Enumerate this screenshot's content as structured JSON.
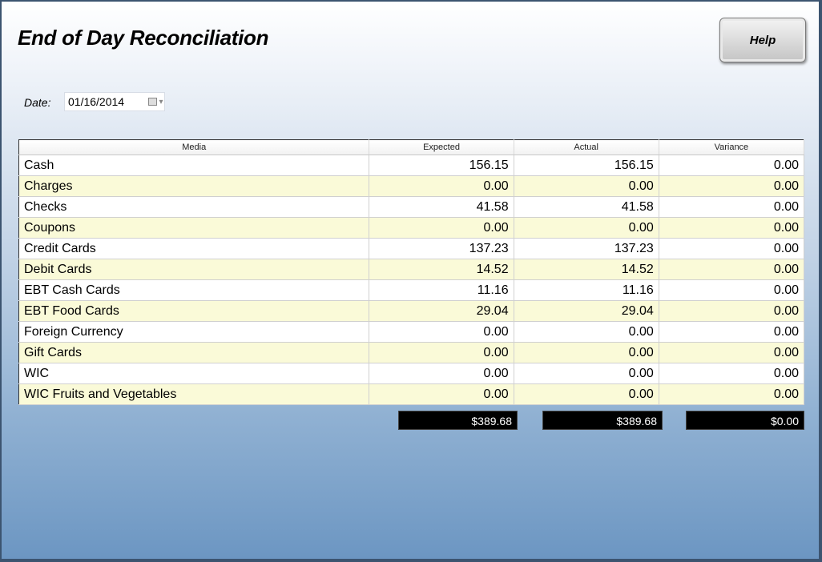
{
  "window": {
    "title": "End of Day Reconciliation",
    "help_label": "Help"
  },
  "date_filter": {
    "label": "Date:",
    "value": "01/16/2014",
    "calendar_icon": "calendar-dropdown-icon"
  },
  "table": {
    "columns": [
      "Media",
      "Expected",
      "Actual",
      "Variance"
    ],
    "rows": [
      {
        "media": "Cash",
        "expected": "156.15",
        "actual": "156.15",
        "variance": "0.00"
      },
      {
        "media": "Charges",
        "expected": "0.00",
        "actual": "0.00",
        "variance": "0.00"
      },
      {
        "media": "Checks",
        "expected": "41.58",
        "actual": "41.58",
        "variance": "0.00"
      },
      {
        "media": "Coupons",
        "expected": "0.00",
        "actual": "0.00",
        "variance": "0.00"
      },
      {
        "media": "Credit Cards",
        "expected": "137.23",
        "actual": "137.23",
        "variance": "0.00"
      },
      {
        "media": "Debit Cards",
        "expected": "14.52",
        "actual": "14.52",
        "variance": "0.00"
      },
      {
        "media": "EBT Cash Cards",
        "expected": "11.16",
        "actual": "11.16",
        "variance": "0.00"
      },
      {
        "media": "EBT Food Cards",
        "expected": "29.04",
        "actual": "29.04",
        "variance": "0.00"
      },
      {
        "media": "Foreign Currency",
        "expected": "0.00",
        "actual": "0.00",
        "variance": "0.00"
      },
      {
        "media": "Gift Cards",
        "expected": "0.00",
        "actual": "0.00",
        "variance": "0.00"
      },
      {
        "media": "WIC",
        "expected": "0.00",
        "actual": "0.00",
        "variance": "0.00"
      },
      {
        "media": "WIC Fruits and Vegetables",
        "expected": "0.00",
        "actual": "0.00",
        "variance": "0.00"
      }
    ]
  },
  "totals": {
    "expected": "$389.68",
    "actual": "$389.68",
    "variance": "$0.00"
  },
  "colors": {
    "row_alt": "#fafad8",
    "total_bg": "#000000",
    "total_text": "#ffffff"
  }
}
